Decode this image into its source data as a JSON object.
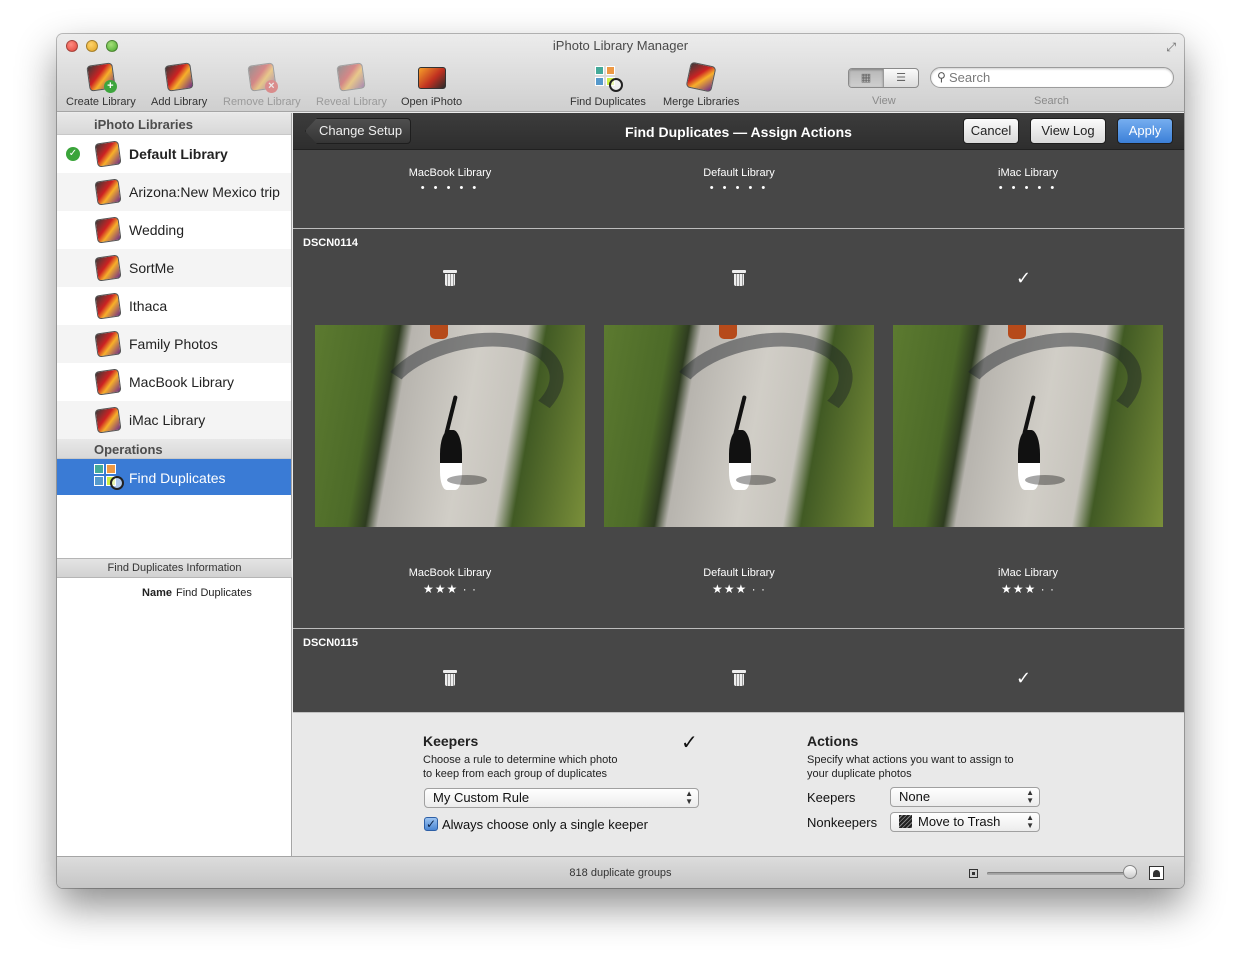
{
  "window": {
    "title": "iPhoto Library Manager"
  },
  "toolbar": {
    "create_library": "Create Library",
    "add_library": "Add Library",
    "remove_library": "Remove Library",
    "reveal_library": "Reveal Library",
    "open_iphoto": "Open iPhoto",
    "find_duplicates": "Find Duplicates",
    "merge_libraries": "Merge Libraries",
    "view_label": "View",
    "search_label": "Search",
    "search_placeholder": "Search"
  },
  "sidebar": {
    "libraries_header": "iPhoto Libraries",
    "libraries": [
      {
        "label": "Default Library",
        "active": true
      },
      {
        "label": "Arizona:New Mexico trip"
      },
      {
        "label": "Wedding"
      },
      {
        "label": "SortMe"
      },
      {
        "label": "Ithaca"
      },
      {
        "label": "Family Photos"
      },
      {
        "label": "MacBook Library"
      },
      {
        "label": "iMac Library"
      }
    ],
    "operations_header": "Operations",
    "operations": [
      {
        "label": "Find Duplicates"
      }
    ],
    "info_header": "Find Duplicates Information",
    "info": {
      "key": "Name",
      "value": "Find Duplicates"
    }
  },
  "main": {
    "back_button": "Change Setup",
    "title": "Find Duplicates — Assign Actions",
    "cancel": "Cancel",
    "view_log": "View Log",
    "apply": "Apply",
    "columns": [
      {
        "name": "MacBook Library",
        "dots": "• • • • •"
      },
      {
        "name": "Default Library",
        "dots": "• • • • •"
      },
      {
        "name": "iMac Library",
        "dots": "• • • • •"
      }
    ],
    "groups": [
      {
        "title": "DSCN0114",
        "actions": [
          "trash",
          "trash",
          "keep"
        ],
        "photos": [
          {
            "library": "MacBook Library",
            "rating": "★★★ · ·"
          },
          {
            "library": "Default Library",
            "rating": "★★★ · ·"
          },
          {
            "library": "iMac Library",
            "rating": "★★★ · ·"
          }
        ]
      },
      {
        "title": "DSCN0115",
        "actions": [
          "trash",
          "trash",
          "keep"
        ]
      }
    ],
    "keep_glyph": "✓"
  },
  "bottom": {
    "keepers_title": "Keepers",
    "keepers_desc_1": "Choose a rule to determine which photo",
    "keepers_desc_2": "to keep from each group of duplicates",
    "rule_value": "My Custom Rule",
    "single_keeper_label": "Always choose only a single keeper",
    "single_keeper_checked": true,
    "actions_title": "Actions",
    "actions_desc_1": "Specify what actions you want to assign to",
    "actions_desc_2": "your duplicate photos",
    "keepers_label": "Keepers",
    "keepers_value": "None",
    "nonkeepers_label": "Nonkeepers",
    "nonkeepers_value": "Move to Trash"
  },
  "status": {
    "count_text": "818 duplicate groups",
    "zoom_level": 0.95
  }
}
